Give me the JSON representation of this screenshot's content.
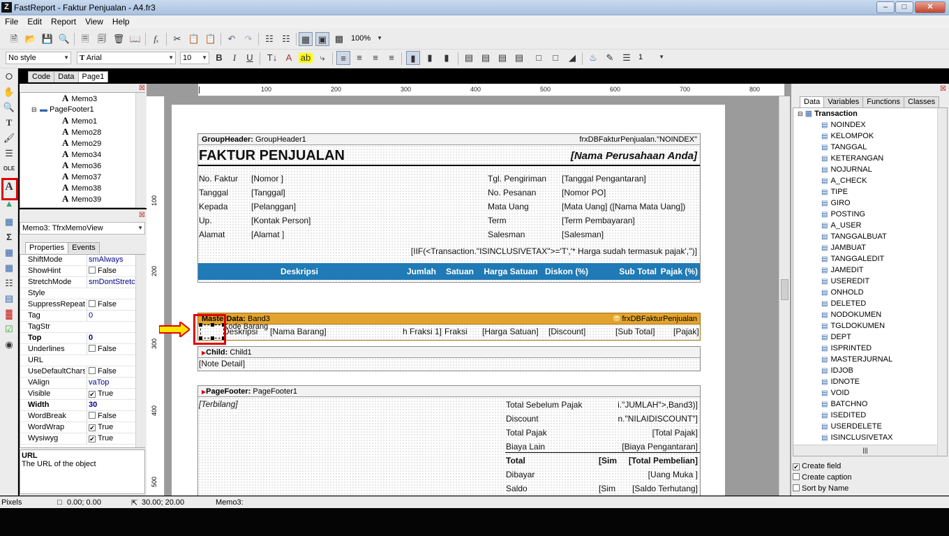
{
  "window": {
    "title": "FastReport - Faktur Penjualan - A4.fr3"
  },
  "menu": [
    "File",
    "Edit",
    "Report",
    "View",
    "Help"
  ],
  "toolbar": {
    "zoom": "100%"
  },
  "format": {
    "style": "No style",
    "font": "Arial",
    "size": "10",
    "line_width": "1"
  },
  "doc_tabs": [
    "Code",
    "Data",
    "Page1"
  ],
  "tree": {
    "items": [
      {
        "label": "Memo3",
        "type": "memo",
        "indent": 2
      },
      {
        "label": "PageFooter1",
        "type": "band",
        "indent": 1
      },
      {
        "label": "Memo1",
        "type": "memo",
        "indent": 2
      },
      {
        "label": "Memo28",
        "type": "memo",
        "indent": 2
      },
      {
        "label": "Memo29",
        "type": "memo",
        "indent": 2
      },
      {
        "label": "Memo34",
        "type": "memo",
        "indent": 2
      },
      {
        "label": "Memo36",
        "type": "memo",
        "indent": 2
      },
      {
        "label": "Memo37",
        "type": "memo",
        "indent": 2
      },
      {
        "label": "Memo38",
        "type": "memo",
        "indent": 2
      },
      {
        "label": "Memo39",
        "type": "memo",
        "indent": 2
      }
    ]
  },
  "inspector": {
    "selected": "Memo3: TfrxMemoView",
    "tabs": [
      "Properties",
      "Events"
    ],
    "props": [
      {
        "k": "ShiftMode",
        "v": "smAlways"
      },
      {
        "k": "ShowHint",
        "v": "False",
        "cb": false
      },
      {
        "k": "StretchMode",
        "v": "smDontStretch"
      },
      {
        "k": "Style",
        "v": ""
      },
      {
        "k": "SuppressRepeat",
        "v": "False",
        "cb": false
      },
      {
        "k": "Tag",
        "v": "0"
      },
      {
        "k": "TagStr",
        "v": ""
      },
      {
        "k": "Top",
        "v": "0",
        "bold": true
      },
      {
        "k": "Underlines",
        "v": "False",
        "cb": false
      },
      {
        "k": "URL",
        "v": "",
        "sel": true
      },
      {
        "k": "UseDefaultCharset",
        "v": "False",
        "cb": false
      },
      {
        "k": "VAlign",
        "v": "vaTop"
      },
      {
        "k": "Visible",
        "v": "True",
        "cb": true
      },
      {
        "k": "Width",
        "v": "30",
        "bold": true
      },
      {
        "k": "WordBreak",
        "v": "False",
        "cb": false
      },
      {
        "k": "WordWrap",
        "v": "True",
        "cb": true
      },
      {
        "k": "Wysiwyg",
        "v": "True",
        "cb": true
      }
    ],
    "help_title": "URL",
    "help_text": "The URL of the object"
  },
  "ruler": {
    "h": [
      "100",
      "200",
      "300",
      "400",
      "500",
      "600",
      "700",
      "800"
    ],
    "v": [
      "100",
      "200",
      "300",
      "400",
      "500"
    ]
  },
  "report": {
    "groupheader": {
      "label": "GroupHeader:",
      "name": "GroupHeader1",
      "condition": "frxDBFakturPenjualan.\"NOINDEX\""
    },
    "title": "FAKTUR PENJUALAN",
    "company": "[Nama Perusahaan Anda]",
    "left_labels": [
      "No. Faktur",
      "Tanggal",
      "Kepada",
      "Up.",
      "Alamat"
    ],
    "left_values": [
      "[Nomor ]",
      "[Tanggal]",
      "[Pelanggan]",
      "[Kontak Person]",
      "[Alamat ]"
    ],
    "right_labels": [
      "Tgl. Pengiriman",
      "No. Pesanan",
      "Mata Uang",
      "Term",
      "Salesman"
    ],
    "right_values": [
      "[Tanggal Pengantaran]",
      "[Nomor PO]",
      "[Mata Uang] ([Nama Mata Uang])",
      "[Term Pembayaran]",
      "[Salesman]"
    ],
    "tax_note": "[IIF(<Transaction.\"ISINCLUSIVETAX\">='T','* Harga sudah termasuk pajak','')]",
    "columns": [
      "Deskripsi",
      "Jumlah",
      "Satuan",
      "Harga Satuan",
      "Diskon (%)",
      "Sub Total",
      "Pajak (%)"
    ],
    "masterdata": {
      "label": "MasterData:",
      "name": "Band3",
      "dataset": "frxDBFakturPenjualan"
    },
    "detail": {
      "code": "Kode Barang",
      "desc": "Deskripsi",
      "name": "[Nama Barang]",
      "qty": "h Fraksi 1]",
      "unit": "Fraksi",
      "price": "[Harga Satuan]",
      "disc": "[Discount]",
      "subtotal": "[Sub Total]",
      "tax": "[Pajak]"
    },
    "child": {
      "label": "Child:",
      "name": "Child1",
      "note": "[Note Detail]"
    },
    "pagefooter": {
      "label": "PageFooter:",
      "name": "PageFooter1",
      "terbilang": "[Terbilang]"
    },
    "totals_labels": [
      "Total Sebelum Pajak",
      "Discount",
      "Total Pajak",
      "Biaya Lain",
      "Total",
      "Dibayar",
      "Saldo"
    ],
    "totals_values": [
      "i.\"JUMLAH\">,Band3)]",
      "n.\"NILAIDISCOUNT\"]",
      "[Total Pajak]",
      "[Biaya Pengantaran]",
      "[Total Pembelian]",
      "[Uang Muka ]",
      "[Saldo Terhutang]"
    ],
    "sim": [
      "[Sim",
      "[Sim"
    ]
  },
  "right_tabs": [
    "Data",
    "Variables",
    "Functions",
    "Classes"
  ],
  "datatree": {
    "root": "Transaction",
    "fields": [
      "NOINDEX",
      "KELOMPOK",
      "TANGGAL",
      "KETERANGAN",
      "NOJURNAL",
      "A_CHECK",
      "TIPE",
      "GIRO",
      "POSTING",
      "A_USER",
      "TANGGALBUAT",
      "JAMBUAT",
      "TANGGALEDIT",
      "JAMEDIT",
      "USEREDIT",
      "ONHOLD",
      "DELETED",
      "NODOKUMEN",
      "TGLDOKUMEN",
      "DEPT",
      "ISPRINTED",
      "MASTERJURNAL",
      "IDJOB",
      "IDNOTE",
      "VOID",
      "BATCHNO",
      "ISEDITED",
      "USERDELETE",
      "ISINCLUSIVETAX"
    ]
  },
  "options": [
    {
      "label": "Create field",
      "checked": true
    },
    {
      "label": "Create caption",
      "checked": false
    },
    {
      "label": "Sort by Name",
      "checked": false
    }
  ],
  "status": {
    "units": "Pixels",
    "pos": "0.00; 0.00",
    "size": "30.00; 20.00",
    "obj": "Memo3:"
  },
  "colors": {
    "header_blue": "#1f7ab5",
    "masterdata_orange": "#e3a42f",
    "highlight_red": "#e00000",
    "arrow_yellow": "#ffe600"
  }
}
